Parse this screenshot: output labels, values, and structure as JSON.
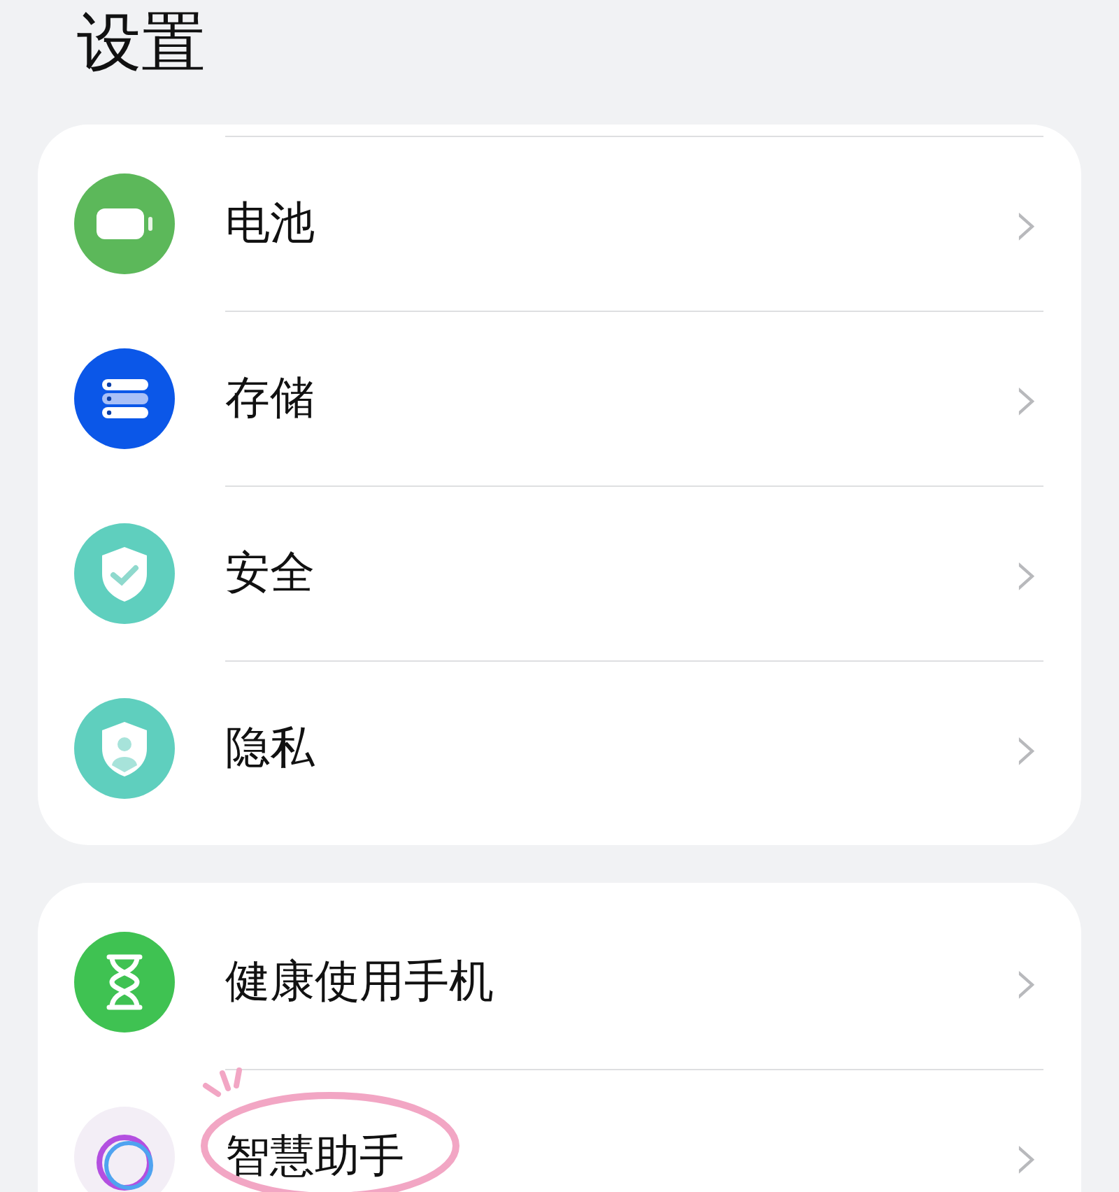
{
  "title": "设置",
  "groups": [
    {
      "items": [
        {
          "kind": "battery",
          "label": "电池",
          "chevron": "›",
          "highlighted": false
        },
        {
          "kind": "storage",
          "label": "存储",
          "chevron": "›",
          "highlighted": false
        },
        {
          "kind": "security",
          "label": "安全",
          "chevron": "›",
          "highlighted": false
        },
        {
          "kind": "privacy",
          "label": "隐私",
          "chevron": "›",
          "highlighted": false
        }
      ]
    },
    {
      "items": [
        {
          "kind": "wellbeing",
          "label": "健康使用手机",
          "chevron": "›",
          "highlighted": false
        },
        {
          "kind": "assistant",
          "label": "智慧助手",
          "chevron": "›",
          "highlighted": true
        }
      ]
    }
  ]
}
